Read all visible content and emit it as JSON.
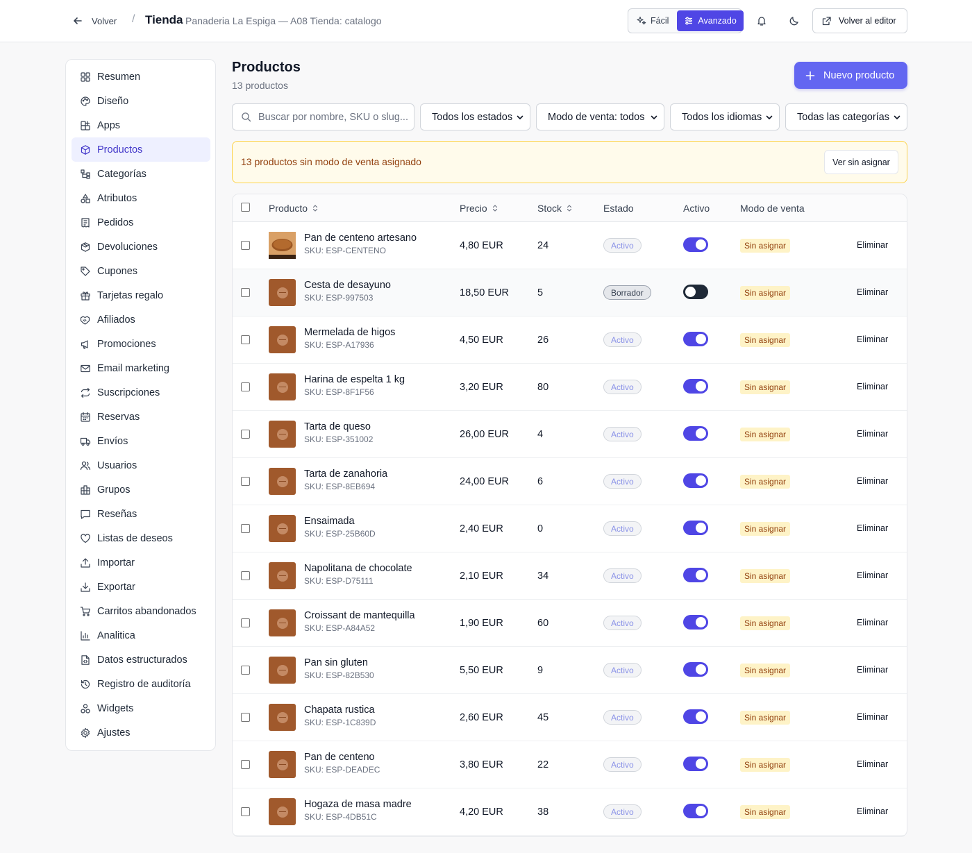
{
  "header": {
    "back_label": "Volver",
    "separator": "/",
    "title": "Tienda",
    "subtitle": "Panaderia La Espiga — A08 Tienda: catalogo",
    "mode_easy": "Fácil",
    "mode_advanced": "Avanzado",
    "editor_label": "Volver al editor"
  },
  "sidebar": {
    "items": [
      {
        "label": "Resumen",
        "icon": "grid-icon"
      },
      {
        "label": "Diseño",
        "icon": "palette-icon"
      },
      {
        "label": "Apps",
        "icon": "apps-icon"
      },
      {
        "label": "Productos",
        "icon": "box-icon"
      },
      {
        "label": "Categorías",
        "icon": "sitemap-icon"
      },
      {
        "label": "Atributos",
        "icon": "shapes-icon"
      },
      {
        "label": "Pedidos",
        "icon": "receipt-icon"
      },
      {
        "label": "Devoluciones",
        "icon": "package-return-icon"
      },
      {
        "label": "Cupones",
        "icon": "tag-icon"
      },
      {
        "label": "Tarjetas regalo",
        "icon": "gift-icon"
      },
      {
        "label": "Afiliados",
        "icon": "handshake-icon"
      },
      {
        "label": "Promociones",
        "icon": "megaphone-icon"
      },
      {
        "label": "Email marketing",
        "icon": "mail-icon"
      },
      {
        "label": "Suscripciones",
        "icon": "repeat-icon"
      },
      {
        "label": "Reservas",
        "icon": "calendar-icon"
      },
      {
        "label": "Envíos",
        "icon": "truck-icon"
      },
      {
        "label": "Usuarios",
        "icon": "users-icon"
      },
      {
        "label": "Grupos",
        "icon": "building-icon"
      },
      {
        "label": "Reseñas",
        "icon": "message-icon"
      },
      {
        "label": "Listas de deseos",
        "icon": "heart-icon"
      },
      {
        "label": "Importar",
        "icon": "upload-icon"
      },
      {
        "label": "Exportar",
        "icon": "download-icon"
      },
      {
        "label": "Carritos abandonados",
        "icon": "cart-icon"
      },
      {
        "label": "Analitica",
        "icon": "bar-chart-icon"
      },
      {
        "label": "Datos estructurados",
        "icon": "file-code-icon"
      },
      {
        "label": "Registro de auditoría",
        "icon": "history-icon"
      },
      {
        "label": "Widgets",
        "icon": "widgets-icon"
      },
      {
        "label": "Ajustes",
        "icon": "gear-icon"
      }
    ],
    "active_index": 3
  },
  "main": {
    "title": "Productos",
    "count": "13 productos",
    "new_button": "Nuevo producto",
    "search_placeholder": "Buscar por nombre, SKU o slug...",
    "filters": [
      "Todos los estados",
      "Modo de venta: todos",
      "Todos los idiomas",
      "Todas las categorías"
    ],
    "alert_text": "13 productos sin modo de venta asignado",
    "alert_button": "Ver sin asignar"
  },
  "table": {
    "columns": {
      "product": "Producto",
      "price": "Precio",
      "stock": "Stock",
      "status": "Estado",
      "active": "Activo",
      "mode": "Modo de venta"
    },
    "delete_label": "Eliminar",
    "rows": [
      {
        "name": "Pan de centeno artesano",
        "sku": "SKU: ESP-CENTENO",
        "price": "4,80 EUR",
        "stock": "24",
        "status": "Activo",
        "active": true,
        "mode": "Sin asignar",
        "photo": true
      },
      {
        "name": "Cesta de desayuno",
        "sku": "SKU: ESP-997503",
        "price": "18,50 EUR",
        "stock": "5",
        "status": "Borrador",
        "active": false,
        "mode": "Sin asignar",
        "photo": false
      },
      {
        "name": "Mermelada de higos",
        "sku": "SKU: ESP-A17936",
        "price": "4,50 EUR",
        "stock": "26",
        "status": "Activo",
        "active": true,
        "mode": "Sin asignar",
        "photo": false
      },
      {
        "name": "Harina de espelta 1 kg",
        "sku": "SKU: ESP-8F1F56",
        "price": "3,20 EUR",
        "stock": "80",
        "status": "Activo",
        "active": true,
        "mode": "Sin asignar",
        "photo": false
      },
      {
        "name": "Tarta de queso",
        "sku": "SKU: ESP-351002",
        "price": "26,00 EUR",
        "stock": "4",
        "status": "Activo",
        "active": true,
        "mode": "Sin asignar",
        "photo": false
      },
      {
        "name": "Tarta de zanahoria",
        "sku": "SKU: ESP-8EB694",
        "price": "24,00 EUR",
        "stock": "6",
        "status": "Activo",
        "active": true,
        "mode": "Sin asignar",
        "photo": false
      },
      {
        "name": "Ensaimada",
        "sku": "SKU: ESP-25B60D",
        "price": "2,40 EUR",
        "stock": "0",
        "status": "Activo",
        "active": true,
        "mode": "Sin asignar",
        "photo": false
      },
      {
        "name": "Napolitana de chocolate",
        "sku": "SKU: ESP-D75111",
        "price": "2,10 EUR",
        "stock": "34",
        "status": "Activo",
        "active": true,
        "mode": "Sin asignar",
        "photo": false
      },
      {
        "name": "Croissant de mantequilla",
        "sku": "SKU: ESP-A84A52",
        "price": "1,90 EUR",
        "stock": "60",
        "status": "Activo",
        "active": true,
        "mode": "Sin asignar",
        "photo": false
      },
      {
        "name": "Pan sin gluten",
        "sku": "SKU: ESP-82B530",
        "price": "5,50 EUR",
        "stock": "9",
        "status": "Activo",
        "active": true,
        "mode": "Sin asignar",
        "photo": false
      },
      {
        "name": "Chapata rustica",
        "sku": "SKU: ESP-1C839D",
        "price": "2,60 EUR",
        "stock": "45",
        "status": "Activo",
        "active": true,
        "mode": "Sin asignar",
        "photo": false
      },
      {
        "name": "Pan de centeno",
        "sku": "SKU: ESP-DEADEC",
        "price": "3,80 EUR",
        "stock": "22",
        "status": "Activo",
        "active": true,
        "mode": "Sin asignar",
        "photo": false
      },
      {
        "name": "Hogaza de masa madre",
        "sku": "SKU: ESP-4DB51C",
        "price": "4,20 EUR",
        "stock": "38",
        "status": "Activo",
        "active": true,
        "mode": "Sin asignar",
        "photo": false
      }
    ]
  },
  "colors": {
    "accent": "#4f46e5",
    "accent_light": "#6366f1",
    "warning_bg": "#fffbeb",
    "warning_text": "#92400e",
    "thumb": "#a0592c"
  }
}
